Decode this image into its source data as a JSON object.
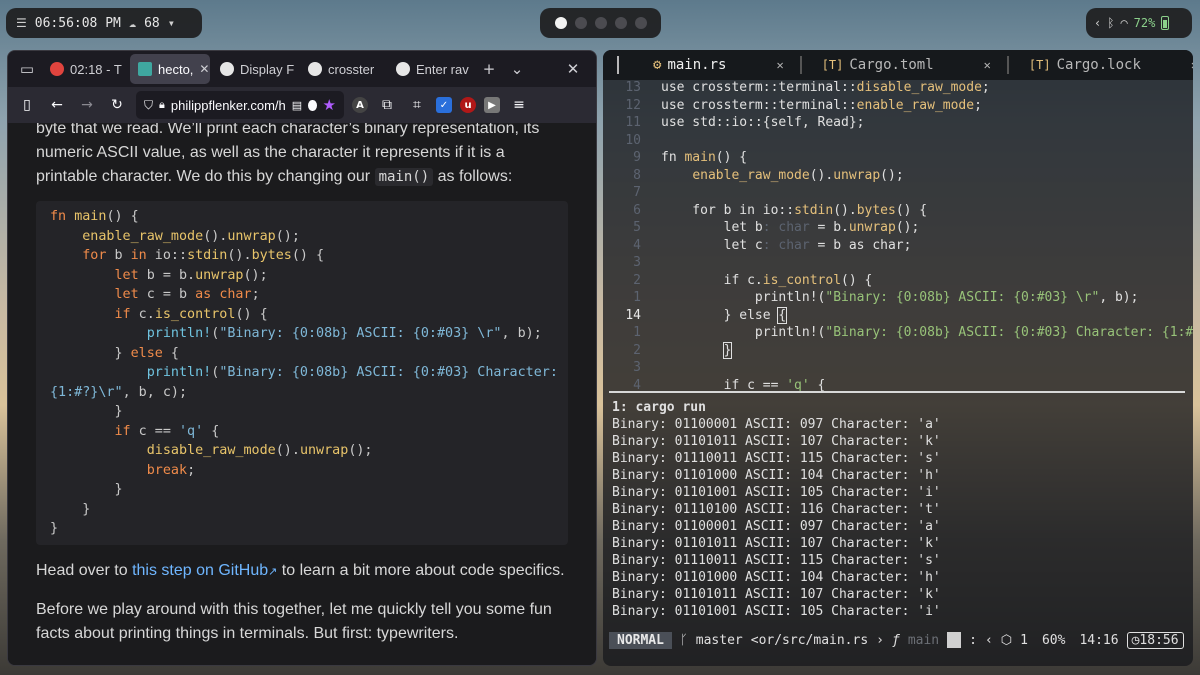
{
  "topbar": {
    "clock": "06:56:08 PM",
    "weather_value": "68",
    "battery": "72%"
  },
  "browser": {
    "tabs": [
      {
        "label": "02:18 - T",
        "fav_color": "#e0443e"
      },
      {
        "label": "hecto,",
        "fav_color": "#3fa7a0"
      },
      {
        "label": "Display F",
        "fav_color": "#e6e6e6"
      },
      {
        "label": "crosster",
        "fav_color": "#e6e6e6"
      },
      {
        "label": "Enter rav",
        "fav_color": "#e6e6e6"
      }
    ],
    "url": "philippflenker.com/h",
    "para1": "byte that we read. We’ll print each character’s binary representation, its numeric ASCII value, as well as the character it represents if it is a printable character. We do this by changing our",
    "para1_code": "main()",
    "para1_end": "as follows:",
    "code_lines": [
      "fn main() {",
      "    enable_raw_mode().unwrap();",
      "    for b in io::stdin().bytes() {",
      "        let b = b.unwrap();",
      "        let c = b as char;",
      "        if c.is_control() {",
      "            println!(\"Binary: {0:08b} ASCII: {0:#03} \\r\", b);",
      "        } else {",
      "            println!(\"Binary: {0:08b} ASCII: {0:#03} Character:",
      "{1:#?}\\r\", b, c);",
      "        }",
      "        if c == 'q' {",
      "            disable_raw_mode().unwrap();",
      "            break;",
      "        }",
      "    }",
      "}"
    ],
    "para2_before": "Head over to ",
    "para2_link": "this step on GitHub",
    "para2_after": " to learn a bit more about code specifics.",
    "para3": "Before we play around with this together, let me quickly tell you some fun facts about printing things in terminals. But first: typewriters."
  },
  "terminal": {
    "buffers": [
      "main.rs",
      "Cargo.toml",
      "Cargo.lock"
    ],
    "editor_lines": [
      {
        "num": "13",
        "text": "use crossterm::terminal::disable_raw_mode;"
      },
      {
        "num": "12",
        "text": "use crossterm::terminal::enable_raw_mode;"
      },
      {
        "num": "11",
        "text": "use std::io::{self, Read};"
      },
      {
        "num": "10",
        "text": ""
      },
      {
        "num": "9",
        "text": "fn main() {"
      },
      {
        "num": "8",
        "text": "    enable_raw_mode().unwrap();"
      },
      {
        "num": "7",
        "text": ""
      },
      {
        "num": "6",
        "text": "    for b in io::stdin().bytes() {"
      },
      {
        "num": "5",
        "text": "        let b: char = b.unwrap();"
      },
      {
        "num": "4",
        "text": "        let c: char = b as char;"
      },
      {
        "num": "3",
        "text": ""
      },
      {
        "num": "2",
        "text": "        if c.is_control() {"
      },
      {
        "num": "1",
        "text": "            println!(\"Binary: {0:08b} ASCII: {0:#03} \\r\", b);"
      },
      {
        "num": "14",
        "text": "        } else {"
      },
      {
        "num": "1",
        "text": "            println!(\"Binary: {0:08b} ASCII: {0:#03} Character: {1:#?"
      },
      {
        "num": "2",
        "text": "        }"
      },
      {
        "num": "3",
        "text": ""
      },
      {
        "num": "4",
        "text": "        if c == 'q' {"
      }
    ],
    "output_header": "1: cargo run",
    "output_lines": [
      "Binary: 01100001 ASCII: 097 Character: 'a'",
      "Binary: 01101011 ASCII: 107 Character: 'k'",
      "Binary: 01110011 ASCII: 115 Character: 's'",
      "Binary: 01101000 ASCII: 104 Character: 'h'",
      "Binary: 01101001 ASCII: 105 Character: 'i'",
      "Binary: 01110100 ASCII: 116 Character: 't'",
      "Binary: 01100001 ASCII: 097 Character: 'a'",
      "Binary: 01101011 ASCII: 107 Character: 'k'",
      "Binary: 01110011 ASCII: 115 Character: 's'",
      "Binary: 01101000 ASCII: 104 Character: 'h'",
      "Binary: 01101011 ASCII: 107 Character: 'k'",
      "Binary: 01101001 ASCII: 105 Character: 'i'"
    ],
    "status": {
      "mode": "NORMAL",
      "branch": "master",
      "path": "<or/src/main.rs",
      "func": "main",
      "count": "1",
      "percent": "60%",
      "position": "14:16",
      "time": "18:56"
    }
  }
}
